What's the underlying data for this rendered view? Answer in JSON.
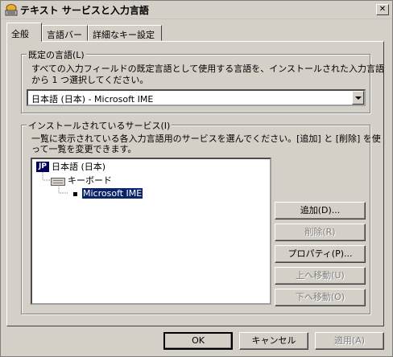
{
  "window": {
    "title": "テキスト サービスと入力言語"
  },
  "tabs": [
    {
      "label": "全般"
    },
    {
      "label": "言語バー"
    },
    {
      "label": "詳細なキー設定"
    }
  ],
  "default_language": {
    "legend": "既定の言語(L)",
    "description_line1": "すべての入力フィールドの既定言語として使用する言語を、インストールされた入力言語",
    "description_line2": "から 1 つ選択してください。",
    "selected": "日本語 (日本) - Microsoft IME"
  },
  "installed_services": {
    "legend": "インストールされているサービス(I)",
    "description_line1": "一覧に表示されている各入力言語用のサービスを選んでください。[追加] と [削除] を使",
    "description_line2": "って一覧を変更できます。",
    "tree": {
      "language_badge": "JP",
      "language": "日本語 (日本)",
      "category": "キーボード",
      "service": "Microsoft IME"
    },
    "buttons": {
      "add": "追加(D)...",
      "remove": "削除(R)",
      "properties": "プロパティ(P)...",
      "move_up": "上へ移動(U)",
      "move_down": "下へ移動(O)"
    }
  },
  "footer": {
    "ok": "OK",
    "cancel": "キャンセル",
    "apply": "適用(A)"
  }
}
